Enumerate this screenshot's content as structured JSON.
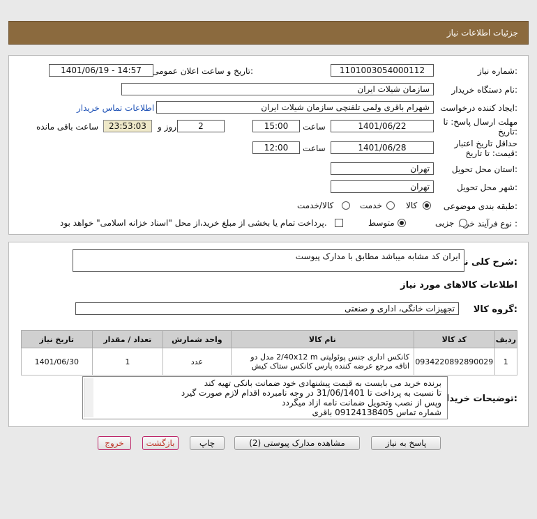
{
  "header": {
    "title": "جزئیات اطلاعات نیاز"
  },
  "form": {
    "need_number": {
      "label": "شماره نیاز:",
      "value": "1101003054000112"
    },
    "announce": {
      "label": "تاریخ و ساعت اعلان عمومی:",
      "value": "1401/06/19 - 14:57"
    },
    "buyer_org": {
      "label": "نام دستگاه خریدار:",
      "value": "سازمان شیلات ایران"
    },
    "requester": {
      "label": "ایجاد کننده درخواست:",
      "value": "شهرام باقری ولمی تلفنچی سازمان شیلات ایران",
      "contact_link": "اطلاعات تماس خریدار"
    },
    "deadline": {
      "label": "مهلت ارسال پاسخ: تا تاریخ:",
      "date": "1401/06/22",
      "time_label": "ساعت",
      "time": "15:00",
      "days": "2",
      "days_label": "روز و",
      "remaining": "23:53:03",
      "remaining_label": "ساعت باقی مانده"
    },
    "validity": {
      "label": "حداقل تاریخ اعتبار قیمت: تا تاریخ:",
      "date": "1401/06/28",
      "time_label": "ساعت",
      "time": "12:00"
    },
    "province": {
      "label": "استان محل تحویل:",
      "value": "تهران"
    },
    "city": {
      "label": "شهر محل تحویل:",
      "value": "تهران"
    },
    "category": {
      "label": "طبقه بندی موضوعی:",
      "options": [
        "کالا",
        "خدمت",
        "کالا/خدمت"
      ],
      "selected": "کالا"
    },
    "process": {
      "label": "نوع فرآیند خرید :",
      "options": [
        "جزیی",
        "متوسط"
      ],
      "selected": "متوسط",
      "payment_note": "پرداخت تمام یا بخشی از مبلغ خرید،از محل \"اسناد خزانه اسلامی\" خواهد بود."
    }
  },
  "description": {
    "label": "شرح کلی نیاز:",
    "value": "ایران کد مشابه میباشد مطابق با مدارک پیوست"
  },
  "goods_info_title": "اطلاعات کالاهای مورد نیاز",
  "goods_group": {
    "label": "گروه کالا:",
    "value": "تجهیزات خانگی، اداری و صنعتی"
  },
  "table": {
    "headers": [
      "ردیف",
      "کد کالا",
      "نام کالا",
      "واحد شمارش",
      "تعداد / مقدار",
      "تاریخ نیاز"
    ],
    "rows": [
      {
        "row": "1",
        "code": "0934220892890029",
        "name": "کانکس اداری جنس پوئولیتی 2/40x12 m مدل دو اتاقه مرجع عرضه کننده پارس کانکس ستاک کیش",
        "unit": "عدد",
        "qty": "1",
        "date": "1401/06/30"
      }
    ]
  },
  "buyer_notes": {
    "label": "توضیحات خریدار:",
    "lines": [
      "برنده خرید می بایست  به قیمت پیشنهادی خود ضمانت بانکی تهیه کند",
      "تا نسبت به پرداخت تا 31/06/1401 در وجه نامبرده اقدام لازم صورت گیرد",
      "وپس از نصب وتحویل ضمانت نامه ازاد میگردد",
      "شماره تماس 09124138405 باقری"
    ]
  },
  "buttons": {
    "reply": "پاسخ به نیاز",
    "attachments": "مشاهده مدارک پیوستی (2)",
    "print": "چاپ",
    "back": "بازگشت",
    "exit": "خروج"
  }
}
